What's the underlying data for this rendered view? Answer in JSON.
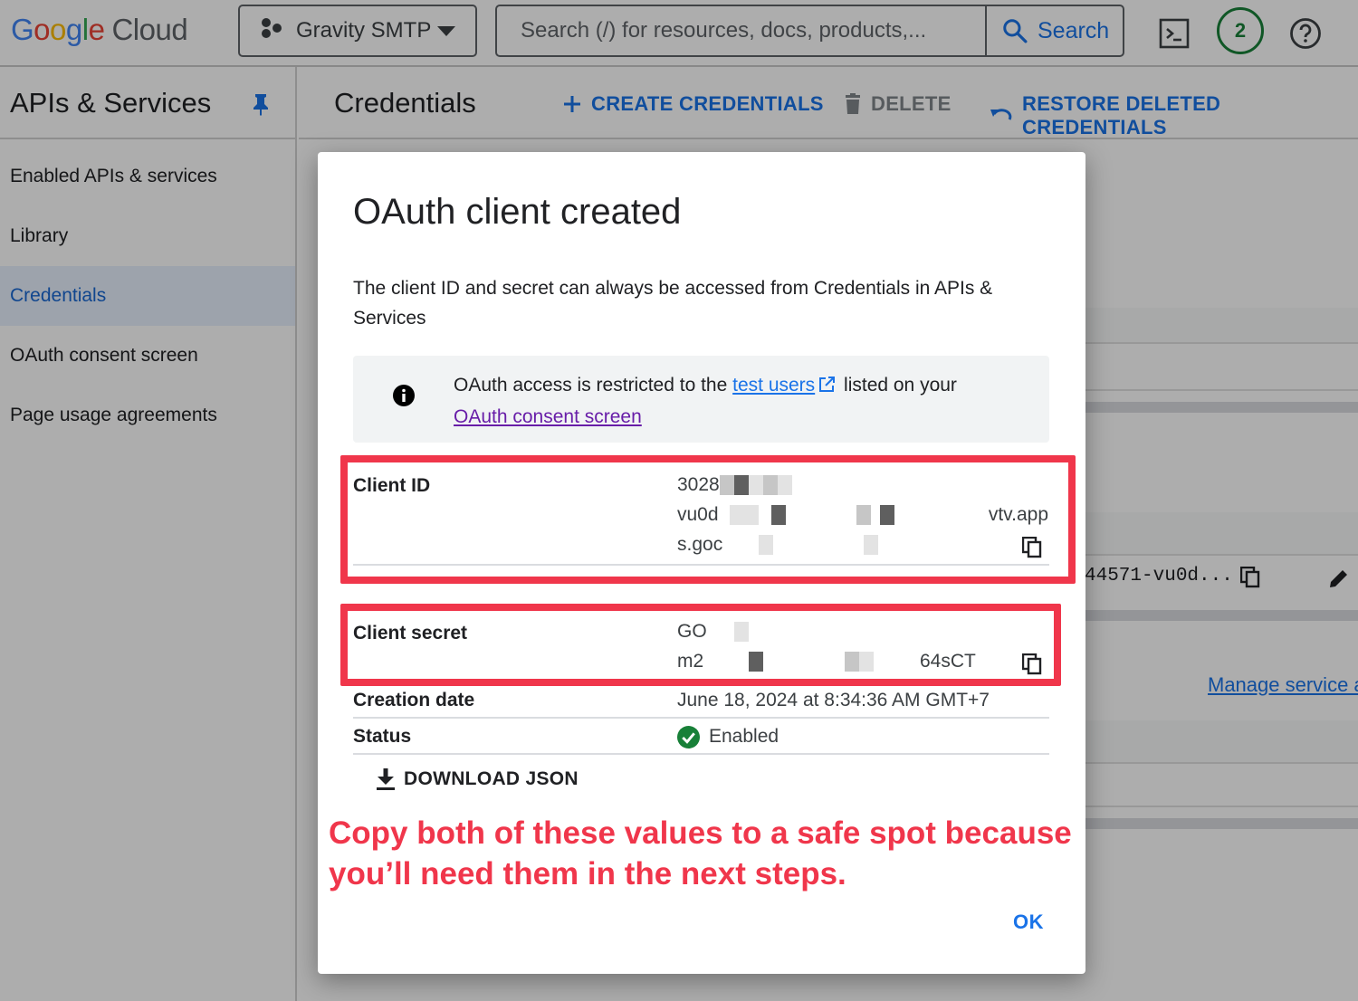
{
  "header": {
    "logo": {
      "g1": "G",
      "g2": "o",
      "g3": "o",
      "g4": "g",
      "g5": "l",
      "g6": "e",
      "cloud": "Cloud"
    },
    "project_name": "Gravity SMTP",
    "search_placeholder": "Search (/) for resources, docs, products,...",
    "search_button": "Search",
    "notifications_count": "2"
  },
  "sidebar": {
    "title": "APIs & Services",
    "items": [
      {
        "label": "Enabled APIs & services",
        "active": false
      },
      {
        "label": "Library",
        "active": false
      },
      {
        "label": "Credentials",
        "active": true
      },
      {
        "label": "OAuth consent screen",
        "active": false
      },
      {
        "label": "Page usage agreements",
        "active": false
      }
    ]
  },
  "content": {
    "title": "Credentials",
    "actions": {
      "create": "CREATE CREDENTIALS",
      "delete": "DELETE",
      "restore": "RESTORE DELETED CREDENTIALS"
    },
    "background_client_id": "44571-vu0d...",
    "manage_link": "Manage service a"
  },
  "dialog": {
    "title": "OAuth client created",
    "description": "The client ID and secret can always be accessed from Credentials in APIs & Services",
    "notice": {
      "before": "OAuth access is restricted to the ",
      "link1": "test users",
      "middle": " listed on your",
      "link2": "OAuth consent screen"
    },
    "client_id": {
      "label": "Client ID",
      "line1": "3028",
      "line2_start": "vu0d",
      "line2_end": "vtv.app",
      "line3": "s.goc"
    },
    "client_secret": {
      "label": "Client secret",
      "line1": "GO",
      "line2_start": "m2",
      "line2_end": "64sCT"
    },
    "creation_date": {
      "label": "Creation date",
      "value": "June 18, 2024 at 8:34:36 AM GMT+7"
    },
    "status": {
      "label": "Status",
      "value": "Enabled"
    },
    "download_label": "DOWNLOAD JSON",
    "callout": "Copy both of these values to a safe spot because you’ll need them in the next steps.",
    "ok_label": "OK"
  },
  "colors": {
    "accent": "#1a73e8",
    "highlight": "#f0364b",
    "enabled": "#188038",
    "visited_link": "#681da8"
  }
}
